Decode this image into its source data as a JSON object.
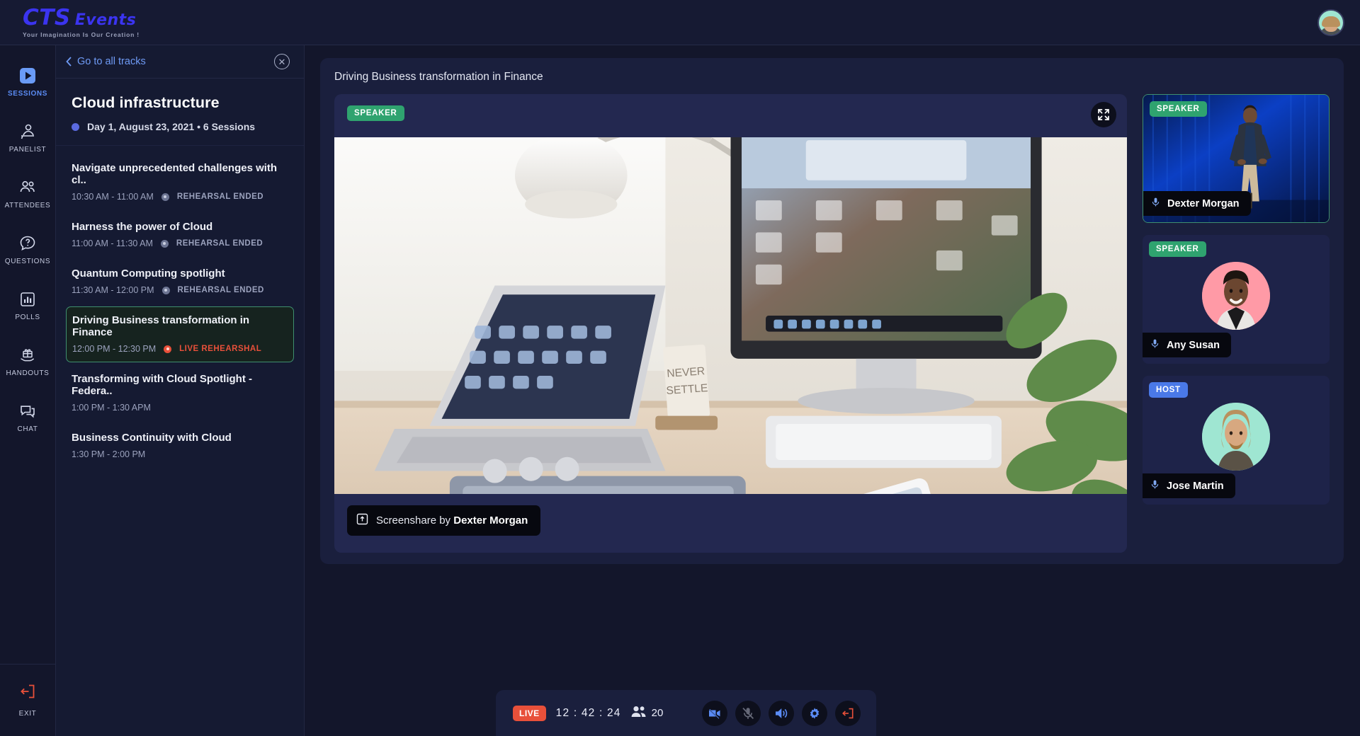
{
  "brand": {
    "name_part1": "CTS",
    "name_part2": "Events",
    "tagline": "Your Imagination Is Our Creation !",
    "accent": "#3b34f0"
  },
  "header": {
    "avatar_name": "user-avatar"
  },
  "sidebar": {
    "items": [
      {
        "label": "SESSIONS",
        "icon": "play-icon",
        "active": true
      },
      {
        "label": "PANELIST",
        "icon": "panelist-icon",
        "active": false
      },
      {
        "label": "ATTENDEES",
        "icon": "attendees-icon",
        "active": false
      },
      {
        "label": "QUESTIONS",
        "icon": "question-icon",
        "active": false
      },
      {
        "label": "POLLS",
        "icon": "chart-bar-icon",
        "active": false
      },
      {
        "label": "HANDOUTS",
        "icon": "handout-icon",
        "active": false
      },
      {
        "label": "CHAT",
        "icon": "chat-icon",
        "active": false
      }
    ],
    "exit": {
      "label": "EXIT",
      "icon": "exit-icon",
      "color": "#e8503a"
    }
  },
  "sessions_panel": {
    "back_label": "Go to all tracks",
    "close_icon": "close-icon",
    "track_title": "Cloud infrastructure",
    "track_meta": "Day 1, August 23, 2021 • 6 Sessions",
    "track_dot_color": "#5b6ae0",
    "sessions": [
      {
        "name": "Navigate unprecedented challenges with cl..",
        "time": "10:30 AM - 11:00 AM",
        "status": "REHEARSAL ENDED",
        "state": "ended",
        "selected": false
      },
      {
        "name": "Harness the power of Cloud",
        "time": "11:00 AM - 11:30 AM",
        "status": "REHEARSAL ENDED",
        "state": "ended",
        "selected": false
      },
      {
        "name": "Quantum Computing spotlight",
        "time": "11:30 AM - 12:00 PM",
        "status": "REHEARSAL ENDED",
        "state": "ended",
        "selected": false
      },
      {
        "name": "Driving Business transformation in Finance",
        "time": "12:00 PM - 12:30 PM",
        "status": "LIVE REHEARSHAL",
        "state": "live",
        "selected": true
      },
      {
        "name": "Transforming with Cloud Spotlight - Federa..",
        "time": "1:00 PM - 1:30 APM",
        "status": "",
        "state": "none",
        "selected": false
      },
      {
        "name": "Business Continuity with Cloud",
        "time": "1:30 PM - 2:00 PM",
        "status": "",
        "state": "none",
        "selected": false
      }
    ]
  },
  "stage": {
    "title": "Driving Business transformation in Finance",
    "video_badge": "SPEAKER",
    "fullscreen_icon": "fullscreen-icon",
    "share_icon": "screenshare-icon",
    "share_prefix": "Screenshare by ",
    "share_name": "Dexter Morgan"
  },
  "participants": [
    {
      "role": "SPEAKER",
      "role_type": "speaker",
      "name": "Dexter Morgan",
      "active": true,
      "avatar_bg": "#0b3fa8",
      "kind": "video",
      "mic_icon": "mic-icon"
    },
    {
      "role": "SPEAKER",
      "role_type": "speaker",
      "name": "Any Susan",
      "active": false,
      "avatar_bg": "#ff9aa6",
      "kind": "avatar",
      "mic_icon": "mic-icon"
    },
    {
      "role": "HOST",
      "role_type": "host",
      "name": "Jose Martin",
      "active": false,
      "avatar_bg": "#9fe6d2",
      "kind": "avatar",
      "mic_icon": "mic-icon"
    }
  ],
  "controls": {
    "live_label": "LIVE",
    "timer": "12 : 42 : 24",
    "attendee_count": "20",
    "attendee_icon": "people-icon",
    "buttons": [
      {
        "name": "camera-off-button",
        "icon": "camera-off-icon",
        "state": "off"
      },
      {
        "name": "mic-mute-button",
        "icon": "mic-off-icon",
        "state": "muted"
      },
      {
        "name": "speaker-button",
        "icon": "speaker-icon",
        "state": "on"
      },
      {
        "name": "settings-button",
        "icon": "gear-icon",
        "state": "on"
      },
      {
        "name": "leave-button",
        "icon": "exit-icon",
        "state": "danger"
      }
    ]
  },
  "colors": {
    "bg": "#13162b",
    "panel": "#1a1f3d",
    "green": "#2fa36f",
    "blue": "#4a79e8",
    "red": "#e8503a",
    "link": "#6f9bf6"
  }
}
